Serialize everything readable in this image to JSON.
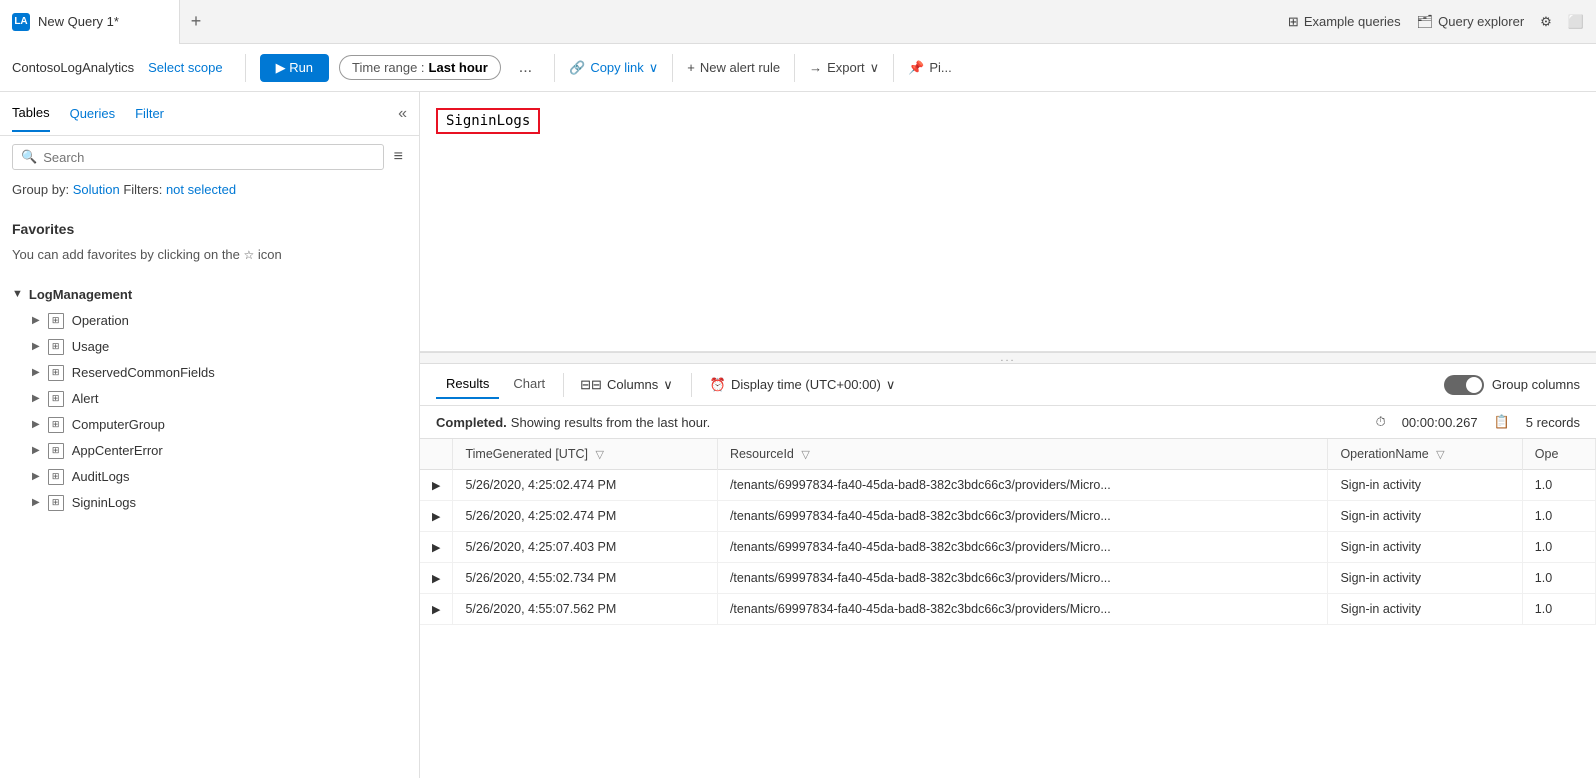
{
  "titleBar": {
    "tab": {
      "icon": "LA",
      "label": "New Query 1*"
    },
    "addLabel": "+",
    "right": {
      "exampleQueries": "Example queries",
      "queryExplorer": "Query explorer",
      "gear": "⚙"
    }
  },
  "toolbar": {
    "workspaceName": "ContosoLogAnalytics",
    "selectScope": "Select scope",
    "runLabel": "▶ Run",
    "timeRange": {
      "label": "Time range : ",
      "value": "Last hour"
    },
    "ellipsis": "...",
    "copyLink": "Copy link",
    "newAlertRule": "New alert rule",
    "export": "Export",
    "pin": "Pi..."
  },
  "sidebar": {
    "tabs": [
      {
        "label": "Tables",
        "active": true
      },
      {
        "label": "Queries",
        "active": false
      },
      {
        "label": "Filter",
        "active": false
      }
    ],
    "collapseIcon": "«",
    "search": {
      "placeholder": "Search"
    },
    "filterIcon": "≡",
    "groupBy": {
      "label": "Group by:",
      "value": "Solution",
      "filtersLabel": "Filters:",
      "filtersValue": "not selected"
    },
    "favorites": {
      "title": "Favorites",
      "description": "You can add favorites by clicking on the",
      "starIcon": "☆",
      "iconSuffix": "icon"
    },
    "logManagement": {
      "groupLabel": "LogManagement",
      "items": [
        {
          "label": "Operation"
        },
        {
          "label": "Usage"
        },
        {
          "label": "ReservedCommonFields"
        },
        {
          "label": "Alert"
        },
        {
          "label": "ComputerGroup"
        },
        {
          "label": "AppCenterError"
        },
        {
          "label": "AuditLogs"
        },
        {
          "label": "SigninLogs"
        }
      ]
    }
  },
  "queryEditor": {
    "queryText": "SigninLogs"
  },
  "dragHandle": "...",
  "results": {
    "tabs": [
      {
        "label": "Results",
        "active": true
      },
      {
        "label": "Chart",
        "active": false
      }
    ],
    "columnsBtn": "Columns",
    "displayTime": "Display time (UTC+00:00)",
    "groupColumns": "Group columns",
    "status": {
      "completed": "Completed.",
      "message": " Showing results from the last hour.",
      "duration": "00:00:00.267",
      "records": "5 records"
    },
    "columns": [
      {
        "label": "TimeGenerated [UTC]"
      },
      {
        "label": "ResourceId"
      },
      {
        "label": "OperationName"
      },
      {
        "label": "Ope"
      }
    ],
    "rows": [
      {
        "time": "5/26/2020, 4:25:02.474 PM",
        "resourceId": "/tenants/69997834-fa40-45da-bad8-382c3bdc66c3/providers/Micro...",
        "operationName": "Sign-in activity",
        "ope": "1.0"
      },
      {
        "time": "5/26/2020, 4:25:02.474 PM",
        "resourceId": "/tenants/69997834-fa40-45da-bad8-382c3bdc66c3/providers/Micro...",
        "operationName": "Sign-in activity",
        "ope": "1.0"
      },
      {
        "time": "5/26/2020, 4:25:07.403 PM",
        "resourceId": "/tenants/69997834-fa40-45da-bad8-382c3bdc66c3/providers/Micro...",
        "operationName": "Sign-in activity",
        "ope": "1.0"
      },
      {
        "time": "5/26/2020, 4:55:02.734 PM",
        "resourceId": "/tenants/69997834-fa40-45da-bad8-382c3bdc66c3/providers/Micro...",
        "operationName": "Sign-in activity",
        "ope": "1.0"
      },
      {
        "time": "5/26/2020, 4:55:07.562 PM",
        "resourceId": "/tenants/69997834-fa40-45da-bad8-382c3bdc66c3/providers/Micro...",
        "operationName": "Sign-in activity",
        "ope": "1.0"
      }
    ]
  }
}
